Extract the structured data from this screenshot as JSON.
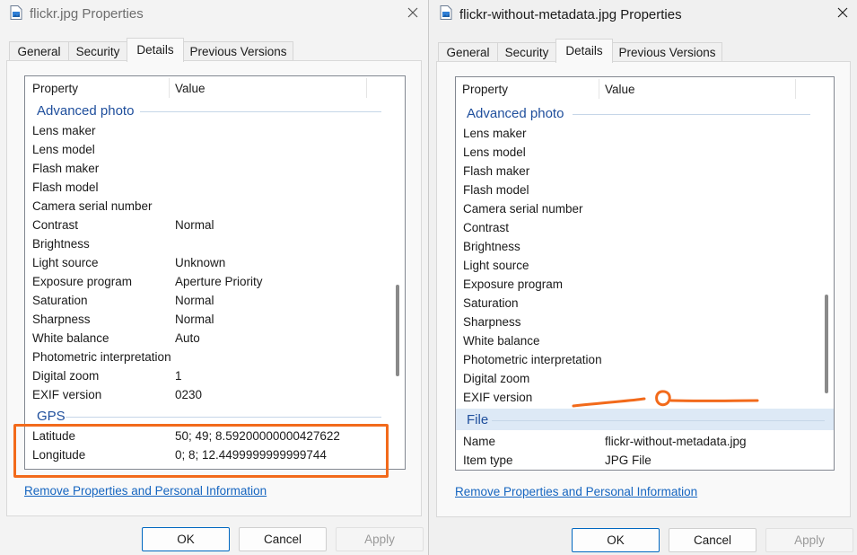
{
  "colors": {
    "accent": "#0067c0",
    "link": "#1565c0",
    "group_header": "#1e4e9c",
    "annotation": "#f26a1b",
    "file_group_bg": "#dde9f6"
  },
  "left": {
    "title": "flickr.jpg Properties",
    "icon": "image-file-icon",
    "tabs": [
      "General",
      "Security",
      "Details",
      "Previous Versions"
    ],
    "active_tab": "Details",
    "headers": {
      "property": "Property",
      "value": "Value"
    },
    "groups": {
      "advanced": "Advanced photo",
      "gps": "GPS"
    },
    "rows": [
      {
        "p": "Lens maker",
        "v": ""
      },
      {
        "p": "Lens model",
        "v": ""
      },
      {
        "p": "Flash maker",
        "v": ""
      },
      {
        "p": "Flash model",
        "v": ""
      },
      {
        "p": "Camera serial number",
        "v": ""
      },
      {
        "p": "Contrast",
        "v": "Normal"
      },
      {
        "p": "Brightness",
        "v": ""
      },
      {
        "p": "Light source",
        "v": "Unknown"
      },
      {
        "p": "Exposure program",
        "v": "Aperture Priority"
      },
      {
        "p": "Saturation",
        "v": "Normal"
      },
      {
        "p": "Sharpness",
        "v": "Normal"
      },
      {
        "p": "White balance",
        "v": "Auto"
      },
      {
        "p": "Photometric interpretation",
        "v": ""
      },
      {
        "p": "Digital zoom",
        "v": "1"
      },
      {
        "p": "EXIF version",
        "v": "0230"
      }
    ],
    "gps_rows": [
      {
        "p": "Latitude",
        "v": "50; 49; 8.59200000000427622"
      },
      {
        "p": "Longitude",
        "v": "0; 8; 12.4499999999999744"
      }
    ],
    "remove_link": "Remove Properties and Personal Information",
    "buttons": {
      "ok": "OK",
      "cancel": "Cancel",
      "apply": "Apply"
    }
  },
  "right": {
    "title": "flickr-without-metadata.jpg Properties",
    "icon": "image-file-icon",
    "tabs": [
      "General",
      "Security",
      "Details",
      "Previous Versions"
    ],
    "active_tab": "Details",
    "headers": {
      "property": "Property",
      "value": "Value"
    },
    "groups": {
      "advanced": "Advanced photo",
      "file": "File"
    },
    "rows": [
      {
        "p": "Lens maker",
        "v": ""
      },
      {
        "p": "Lens model",
        "v": ""
      },
      {
        "p": "Flash maker",
        "v": ""
      },
      {
        "p": "Flash model",
        "v": ""
      },
      {
        "p": "Camera serial number",
        "v": ""
      },
      {
        "p": "Contrast",
        "v": ""
      },
      {
        "p": "Brightness",
        "v": ""
      },
      {
        "p": "Light source",
        "v": ""
      },
      {
        "p": "Exposure program",
        "v": ""
      },
      {
        "p": "Saturation",
        "v": ""
      },
      {
        "p": "Sharpness",
        "v": ""
      },
      {
        "p": "White balance",
        "v": ""
      },
      {
        "p": "Photometric interpretation",
        "v": ""
      },
      {
        "p": "Digital zoom",
        "v": ""
      },
      {
        "p": "EXIF version",
        "v": ""
      }
    ],
    "file_rows": [
      {
        "p": "Name",
        "v": "flickr-without-metadata.jpg"
      },
      {
        "p": "Item type",
        "v": "JPG File"
      }
    ],
    "remove_link": "Remove Properties and Personal Information",
    "buttons": {
      "ok": "OK",
      "cancel": "Cancel",
      "apply": "Apply"
    }
  }
}
